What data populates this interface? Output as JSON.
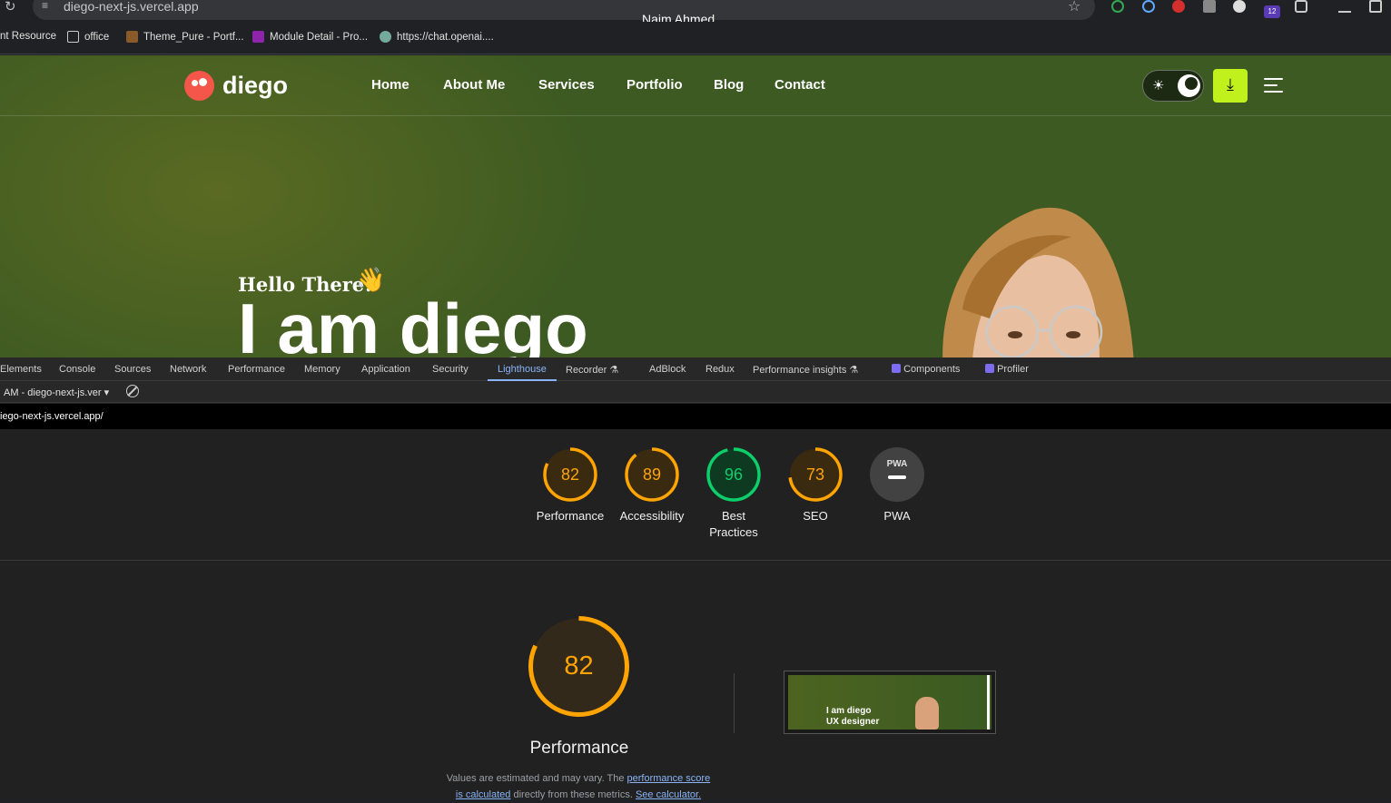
{
  "browser": {
    "url": "diego-next-js.vercel.app",
    "profile_name": "Naim Ahmed",
    "bookmarks": [
      "nt Resource",
      "office",
      "Theme_Pure - Portf...",
      "Module Detail - Pro...",
      "https://chat.openai...."
    ],
    "extension_badge": "12"
  },
  "site": {
    "logo_text": "diego",
    "nav": [
      "Home",
      "About Me",
      "Services",
      "Portfolio",
      "Blog",
      "Contact"
    ],
    "hero_greeting": "Hello There!",
    "hero_name": "I am diego",
    "accent": "#c1f11d"
  },
  "devtools": {
    "tabs": [
      "Elements",
      "Console",
      "Sources",
      "Network",
      "Performance",
      "Memory",
      "Application",
      "Security",
      "Lighthouse",
      "Recorder",
      "AdBlock",
      "Redux",
      "Performance insights",
      "Components",
      "Profiler"
    ],
    "active_tab": "Lighthouse",
    "report_select": "AM - diego-next-js.ver",
    "audited_url": "iego-next-js.vercel.app/"
  },
  "lighthouse": {
    "scores": [
      {
        "label": "Performance",
        "value": 82,
        "color": "#ffa400"
      },
      {
        "label": "Accessibility",
        "value": 89,
        "color": "#ffa400"
      },
      {
        "label": "Best\nPractices",
        "value": 96,
        "color": "#0cce6b"
      },
      {
        "label": "SEO",
        "value": 73,
        "color": "#ffa400"
      },
      {
        "label": "PWA",
        "value": null,
        "color": "#9e9e9e",
        "badge": "PWA"
      }
    ],
    "main": {
      "value": "82",
      "title": "Performance",
      "note_pre": "Values are estimated and may vary. The ",
      "note_link1": "performance score",
      "note_mid": "is calculated",
      "note_mid2": " directly from these metrics. ",
      "note_link2": "See calculator."
    },
    "thumb_line1": "I am diego",
    "thumb_line2": "UX designer"
  }
}
